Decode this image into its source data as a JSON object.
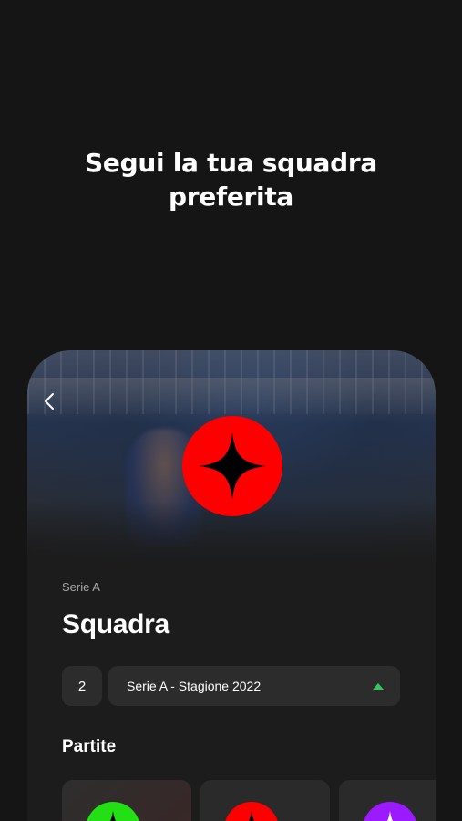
{
  "headline": {
    "line1": "Segui la tua squadra",
    "line2": "preferita"
  },
  "team": {
    "league_label": "Serie A",
    "name": "Squadra",
    "logo_color": "#ff0000"
  },
  "controls": {
    "number_value": "2",
    "season_selected": "Serie A - Stagione 2022",
    "accent_color": "#34c759"
  },
  "matches": {
    "title": "Partite",
    "cards": [
      {
        "logo_color": "#22e014"
      },
      {
        "logo_color": "#ff0000"
      },
      {
        "logo_color": "#9b1aff"
      }
    ]
  },
  "icons": {
    "back": "chevron-left-icon",
    "logo": "four-point-star-icon",
    "dropdown": "caret-up-icon"
  }
}
